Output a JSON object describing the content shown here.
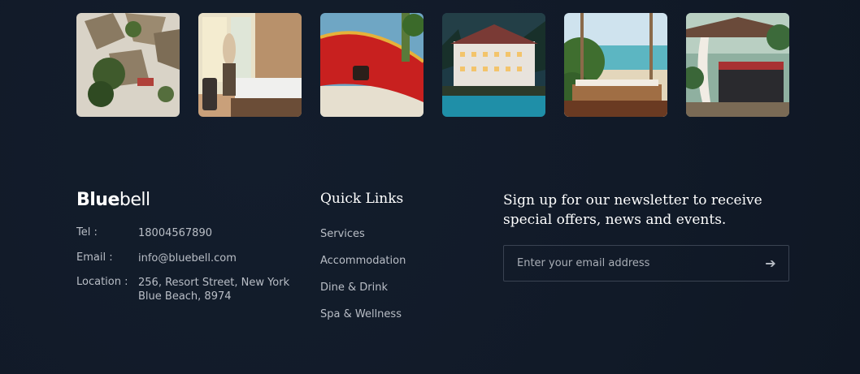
{
  "gallery": {
    "images": [
      {
        "name": "aerial-thatched-huts-image"
      },
      {
        "name": "woman-hotel-room-window-image"
      },
      {
        "name": "red-hammock-beach-image"
      },
      {
        "name": "lakeside-hotel-night-image"
      },
      {
        "name": "beach-swing-bed-image"
      },
      {
        "name": "garden-gazebo-image"
      }
    ]
  },
  "footer": {
    "brand": {
      "bold": "Blue",
      "light": "bell"
    },
    "contact": {
      "tel_label": "Tel :",
      "tel_value": "18004567890",
      "email_label": "Email :",
      "email_value": "info@bluebell.com",
      "location_label": "Location :",
      "location_line1": "256, Resort Street, New York",
      "location_line2": "Blue Beach, 8974"
    },
    "quick_links": {
      "title": "Quick Links",
      "items": [
        "Services",
        "Accommodation",
        "Dine & Drink",
        "Spa & Wellness"
      ]
    },
    "newsletter": {
      "title": "Sign up for our newsletter to receive special offers, news and events.",
      "placeholder": "Enter your email address",
      "submit_icon": "arrow-right-icon",
      "submit_glyph": "➔"
    }
  }
}
